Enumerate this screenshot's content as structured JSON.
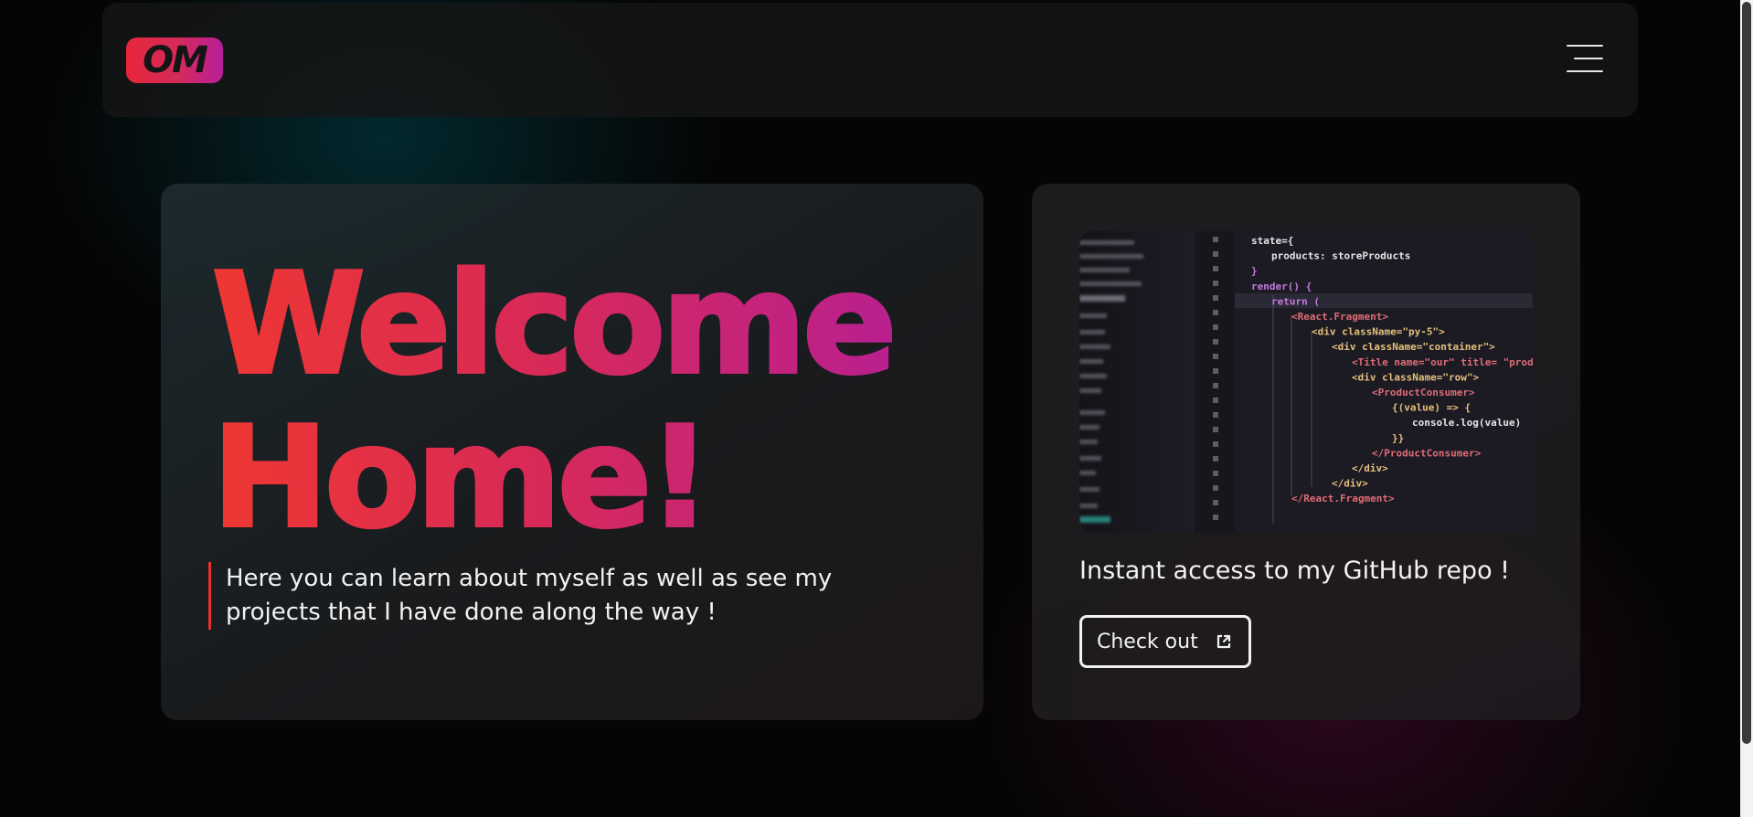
{
  "navbar": {
    "logo_text": "OM",
    "menu_icon": "hamburger-menu-icon"
  },
  "hero": {
    "headline_line1": "Welcome",
    "headline_line2": "Home!",
    "intro": "Here you can learn about myself as well as see my projects that I have done along the way !"
  },
  "github_card": {
    "image_description_icon": "code-screenshot",
    "code_lines": [
      "state={",
      "products: storeProducts",
      "}",
      "render() {",
      "return (",
      "<React.Fragment>",
      "<div className=\"py-5\">",
      "<div className=\"container\">",
      "<Title name=\"our\" title= \"product",
      "<div className=\"row\">",
      "<ProductConsumer>",
      "{(value) => {",
      "console.log(value)",
      "}}",
      "</ProductConsumer>",
      "</div>",
      "</div>",
      "</React.Fragment>"
    ],
    "text": "Instant access to my GitHub repo !",
    "button_label": "Check out",
    "button_icon": "external-link-icon"
  },
  "colors": {
    "background": "#050505",
    "accent_red": "#ef3733",
    "accent_pink": "#da2a55",
    "accent_magenta": "#b9208f",
    "text": "#f2f2f2"
  }
}
